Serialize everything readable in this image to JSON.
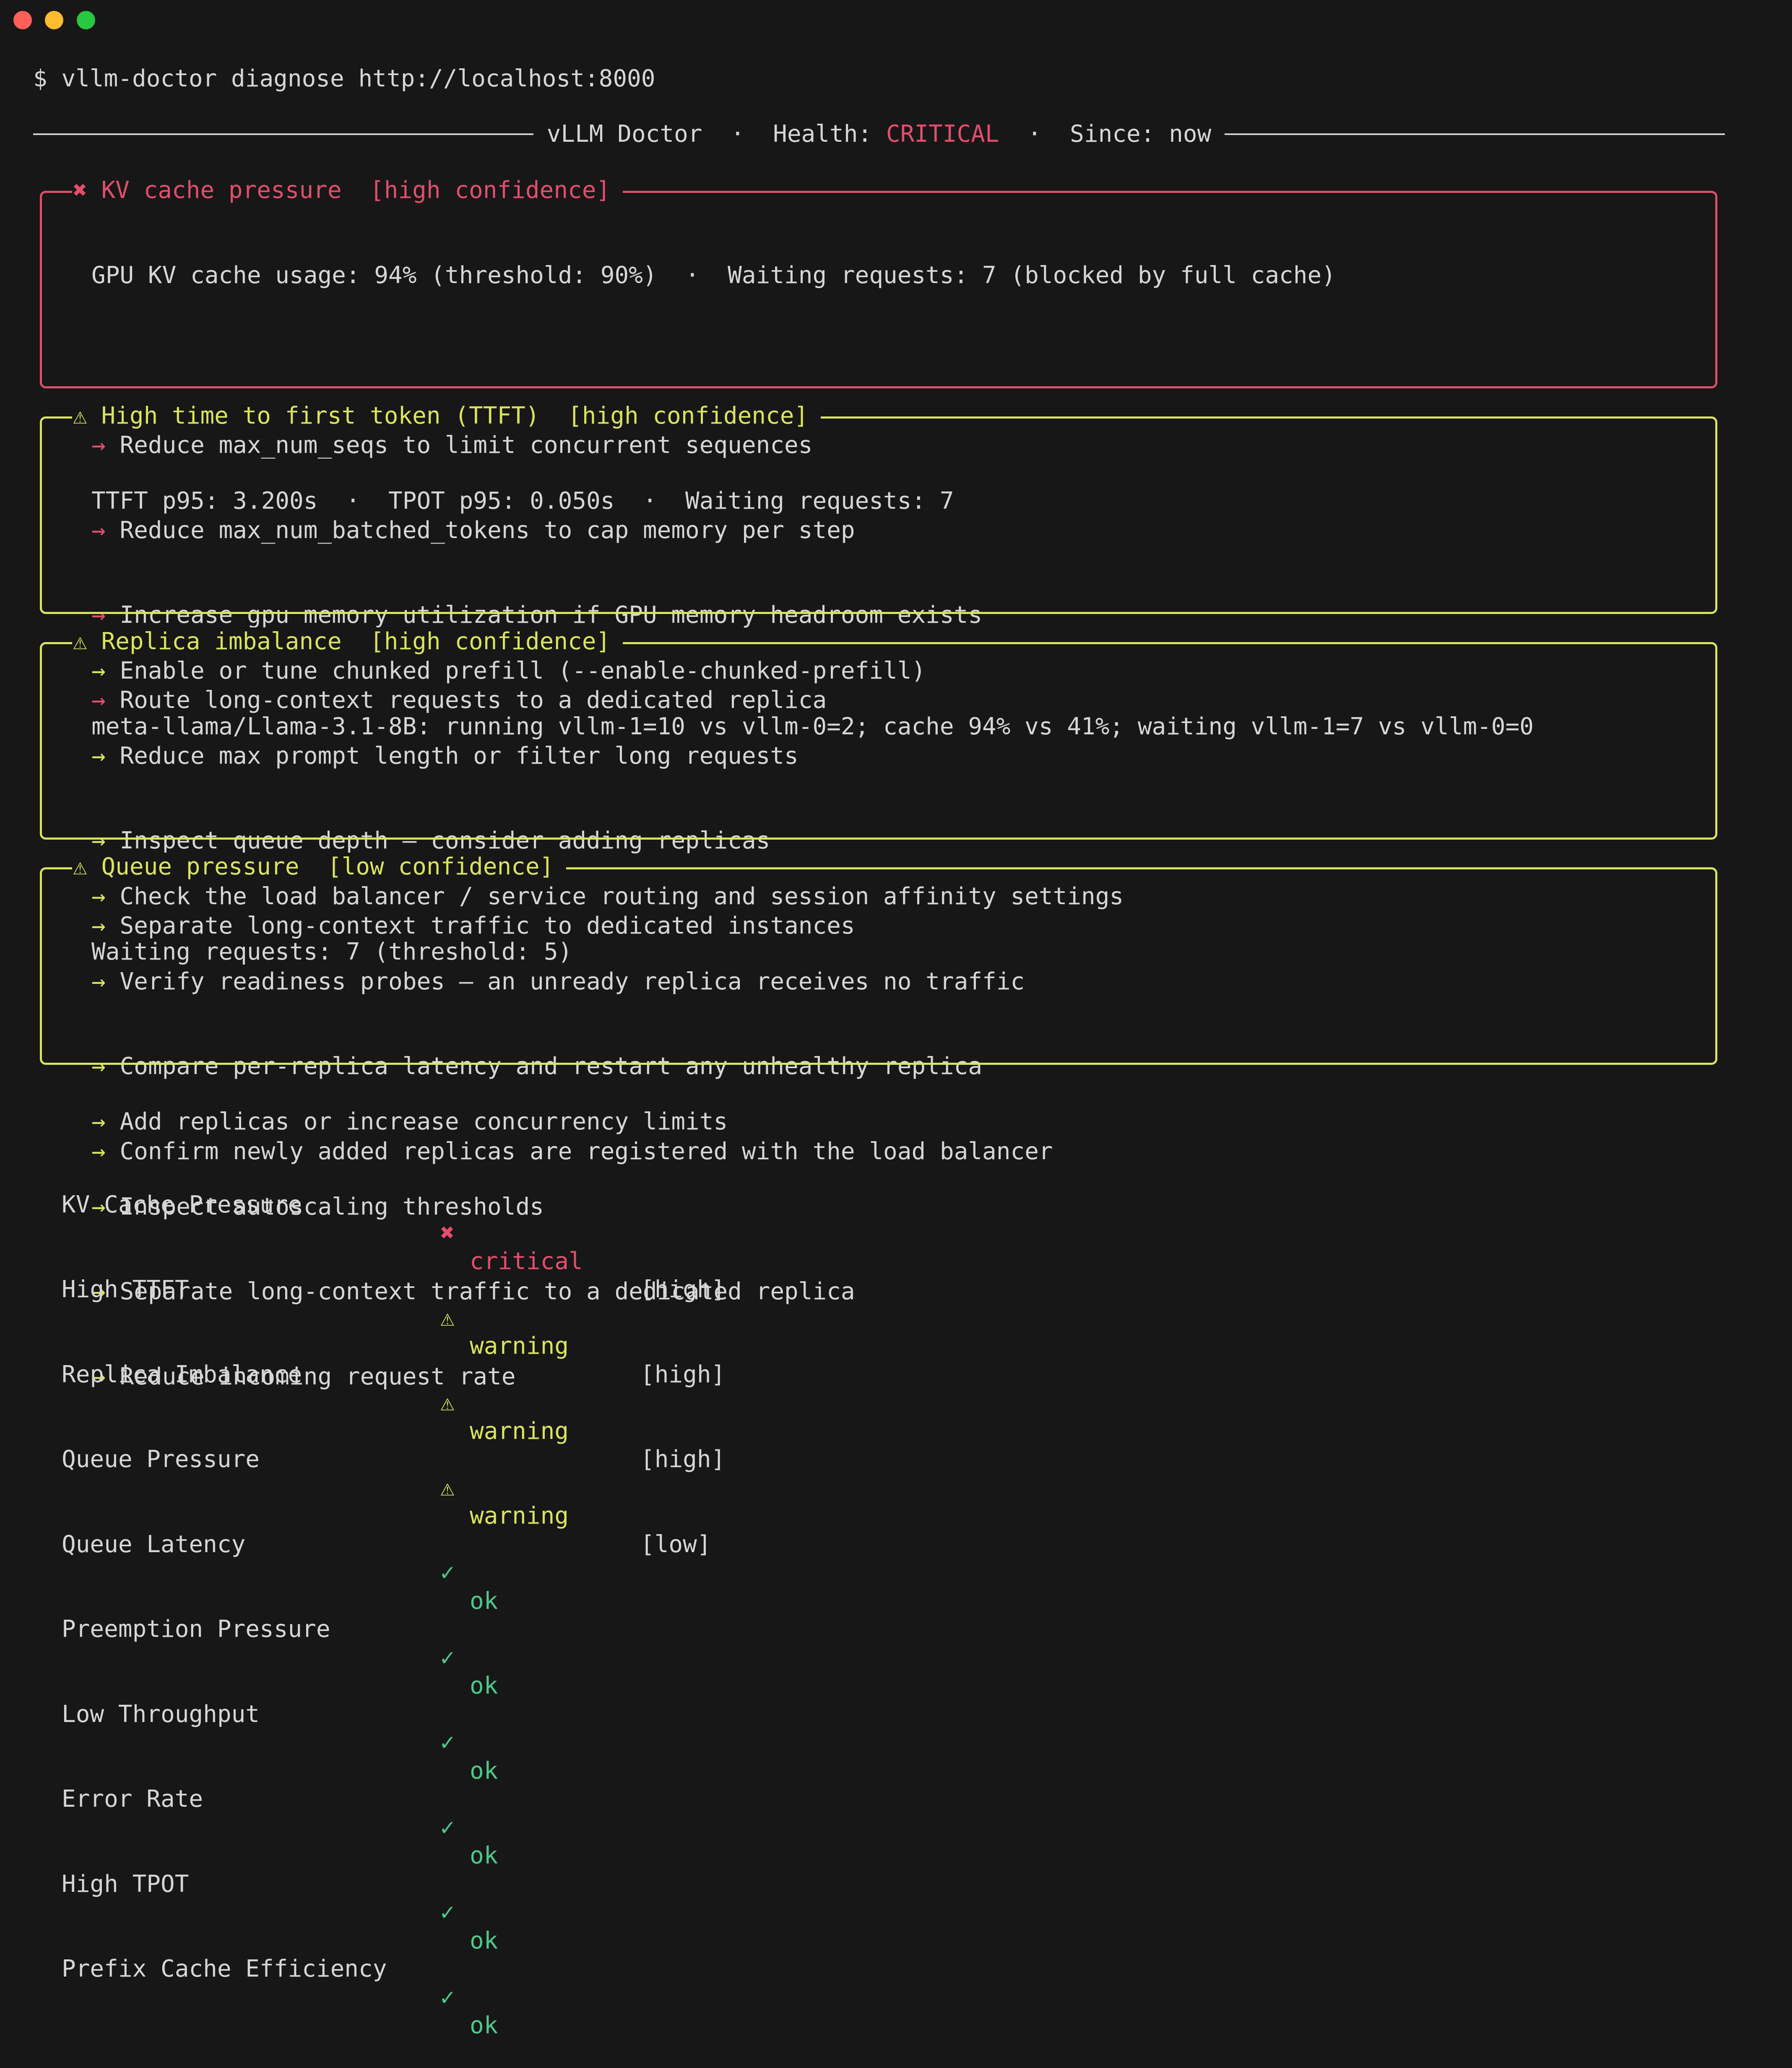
{
  "terminal": {
    "prompt_symbol": "$",
    "command": "vllm-doctor diagnose http://localhost:8000"
  },
  "header": {
    "app_name": "vLLM Doctor",
    "separator": "·",
    "health_label": "Health:",
    "health_value": "CRITICAL",
    "since_label": "Since:",
    "since_value": "now"
  },
  "findings": [
    {
      "icon": "✖",
      "title": "KV cache pressure",
      "confidence": "[high confidence]",
      "summary": "GPU KV cache usage: 94% (threshold: 90%)  ·  Waiting requests: 7 (blocked by full cache)",
      "recommendations": [
        "Reduce max_num_seqs to limit concurrent sequences",
        "Reduce max_num_batched_tokens to cap memory per step",
        "Increase gpu_memory_utilization if GPU memory headroom exists",
        "Route long-context requests to a dedicated replica"
      ]
    },
    {
      "icon": "⚠",
      "title": "High time to first token (TTFT)",
      "confidence": "[high confidence]",
      "summary": "TTFT p95: 3.200s  ·  TPOT p95: 0.050s  ·  Waiting requests: 7",
      "recommendations": [
        "Enable or tune chunked prefill (--enable-chunked-prefill)",
        "Reduce max prompt length or filter long requests",
        "Inspect queue depth — consider adding replicas",
        "Separate long-context traffic to dedicated instances"
      ]
    },
    {
      "icon": "⚠",
      "title": "Replica imbalance",
      "confidence": "[high confidence]",
      "summary": "meta-llama/Llama-3.1-8B: running vllm-1=10 vs vllm-0=2; cache 94% vs 41%; waiting vllm-1=7 vs vllm-0=0",
      "recommendations": [
        "Check the load balancer / service routing and session affinity settings",
        "Verify readiness probes — an unready replica receives no traffic",
        "Compare per-replica latency and restart any unhealthy replica",
        "Confirm newly added replicas are registered with the load balancer"
      ]
    },
    {
      "icon": "⚠",
      "title": "Queue pressure",
      "confidence": "[low confidence]",
      "summary": "Waiting requests: 7 (threshold: 5)",
      "recommendations": [
        "Add replicas or increase concurrency limits",
        "Inspect autoscaling thresholds",
        "Separate long-context traffic to a dedicated replica",
        "Reduce incoming request rate"
      ]
    }
  ],
  "arrow_glyph": "→",
  "summary_table": [
    {
      "name": "KV Cache Pressure",
      "icon": "✖",
      "status": "critical",
      "confidence": "[high]"
    },
    {
      "name": "High TTFT",
      "icon": "⚠",
      "status": "warning",
      "confidence": "[high]"
    },
    {
      "name": "Replica Imbalance",
      "icon": "⚠",
      "status": "warning",
      "confidence": "[high]"
    },
    {
      "name": "Queue Pressure",
      "icon": "⚠",
      "status": "warning",
      "confidence": "[low]"
    },
    {
      "name": "Queue Latency",
      "icon": "✓",
      "status": "ok",
      "confidence": ""
    },
    {
      "name": "Preemption Pressure",
      "icon": "✓",
      "status": "ok",
      "confidence": ""
    },
    {
      "name": "Low Throughput",
      "icon": "✓",
      "status": "ok",
      "confidence": ""
    },
    {
      "name": "Error Rate",
      "icon": "✓",
      "status": "ok",
      "confidence": ""
    },
    {
      "name": "High TPOT",
      "icon": "✓",
      "status": "ok",
      "confidence": ""
    },
    {
      "name": "Prefix Cache Efficiency",
      "icon": "✓",
      "status": "ok",
      "confidence": ""
    }
  ],
  "colors": {
    "background": "#171717",
    "text": "#d6d6d6",
    "critical": "#e24e6d",
    "warning": "#d9e45c",
    "ok": "#4ec98a"
  }
}
